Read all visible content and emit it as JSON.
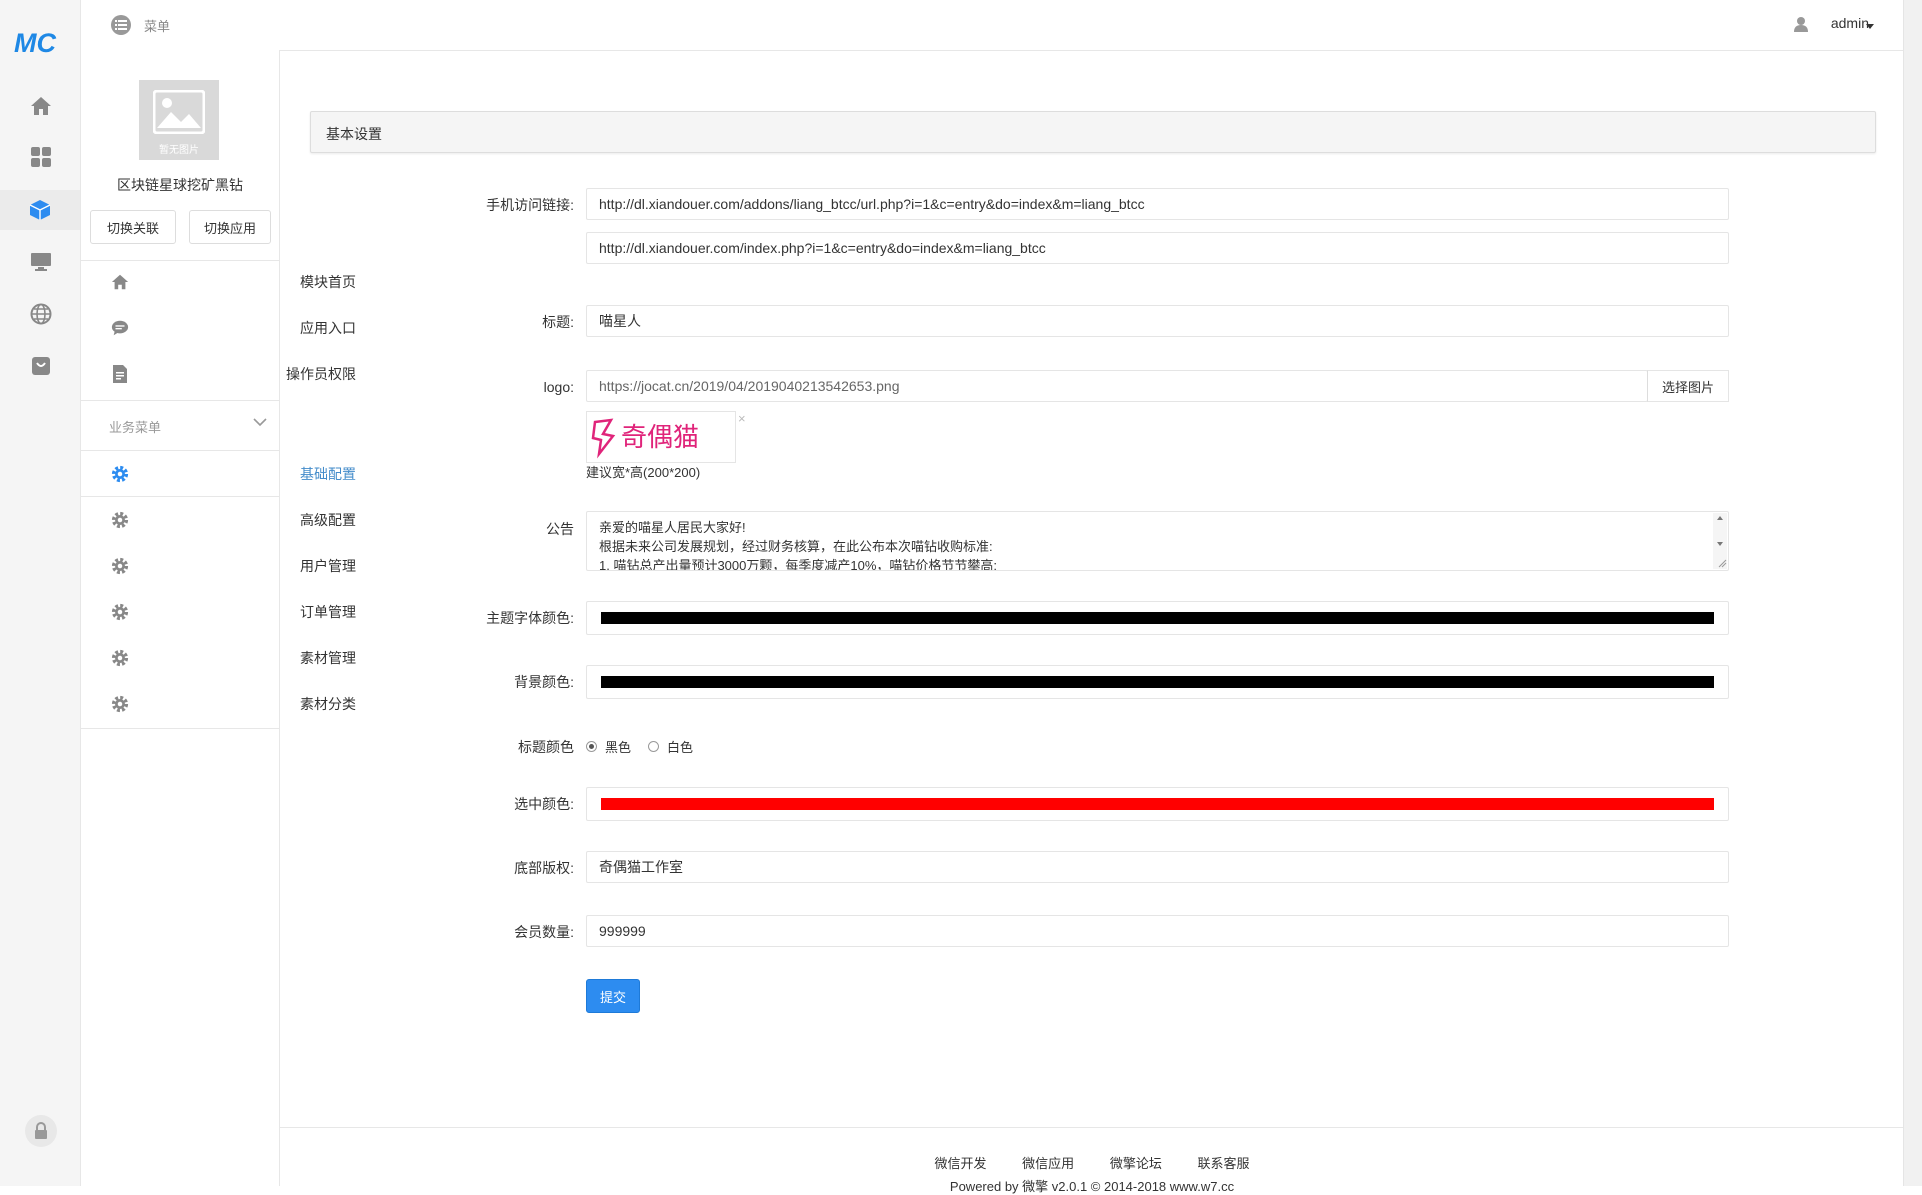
{
  "rail": {
    "brand": "MC",
    "icons": [
      "home-icon",
      "apps-icon",
      "cube-icon",
      "monitor-icon",
      "globe-icon",
      "bag-icon",
      "lock-icon"
    ]
  },
  "sidebar": {
    "thumb_caption": "暂无图片",
    "app_name": "区块链星球挖矿黑钻",
    "switch_link": "切换关联",
    "switch_app": "切换应用",
    "items": [
      {
        "label": "模块首页",
        "icon": "home-icon"
      },
      {
        "label": "应用入口",
        "icon": "chat-icon"
      },
      {
        "label": "操作员权限",
        "icon": "document-icon"
      }
    ],
    "group_label": "业务菜单",
    "biz_items": [
      {
        "label": "基础配置",
        "icon": "gear-icon",
        "active": true
      },
      {
        "label": "高级配置",
        "icon": "gear-icon"
      },
      {
        "label": "用户管理",
        "icon": "gear-icon"
      },
      {
        "label": "订单管理",
        "icon": "gear-icon"
      },
      {
        "label": "素材管理",
        "icon": "gear-icon"
      },
      {
        "label": "素材分类",
        "icon": "gear-icon"
      }
    ]
  },
  "topbar": {
    "menu_label": "菜单",
    "user": "admin"
  },
  "panel": {
    "title": "基本设置"
  },
  "form": {
    "mobile_link_label": "手机访问链接:",
    "mobile_link_1": "http://dl.xiandouer.com/addons/liang_btcc/url.php?i=1&c=entry&do=index&m=liang_btcc",
    "mobile_link_2": "http://dl.xiandouer.com/index.php?i=1&c=entry&do=index&m=liang_btcc",
    "title_label": "标题:",
    "title_value": "喵星人",
    "logo_label": "logo:",
    "logo_value": "https://jocat.cn/2019/04/20190402135426​53.png",
    "logo_button": "选择图片",
    "logo_preview_text": "奇偶猫",
    "logo_hint": "建议宽*高(200*200)",
    "notice_label": "公告",
    "notice_lines": [
      "亲爱的喵星人居民大家好!",
      "根据未来公司发展规划，经过财务核算，在此公布本次喵钻收购标准:",
      "1. 喵钻总产出量预计3000万颗，每季度减产10%，喵钻价格节节攀高;"
    ],
    "theme_font_color_label": "主题字体颜色:",
    "theme_font_color": "#000000",
    "bg_color_label": "背景颜色:",
    "bg_color": "#000000",
    "title_color_label": "标题颜色",
    "title_color_options": [
      "黑色",
      "白色"
    ],
    "title_color_selected": "黑色",
    "selected_color_label": "选中颜色:",
    "selected_color": "#ff0000",
    "copyright_label": "底部版权:",
    "copyright_value": "奇偶猫工作室",
    "member_count_label": "会员数量:",
    "member_count_value": "999999",
    "submit_label": "提交"
  },
  "footer": {
    "links": [
      "微信开发",
      "微信应用",
      "微擎论坛",
      "联系客服"
    ],
    "powered": "Powered by 微擎 v2.0.1 © 2014-2018 www.w7.cc"
  },
  "colors": {
    "accent": "#2d8cf0",
    "active_menu": "#428bca"
  }
}
